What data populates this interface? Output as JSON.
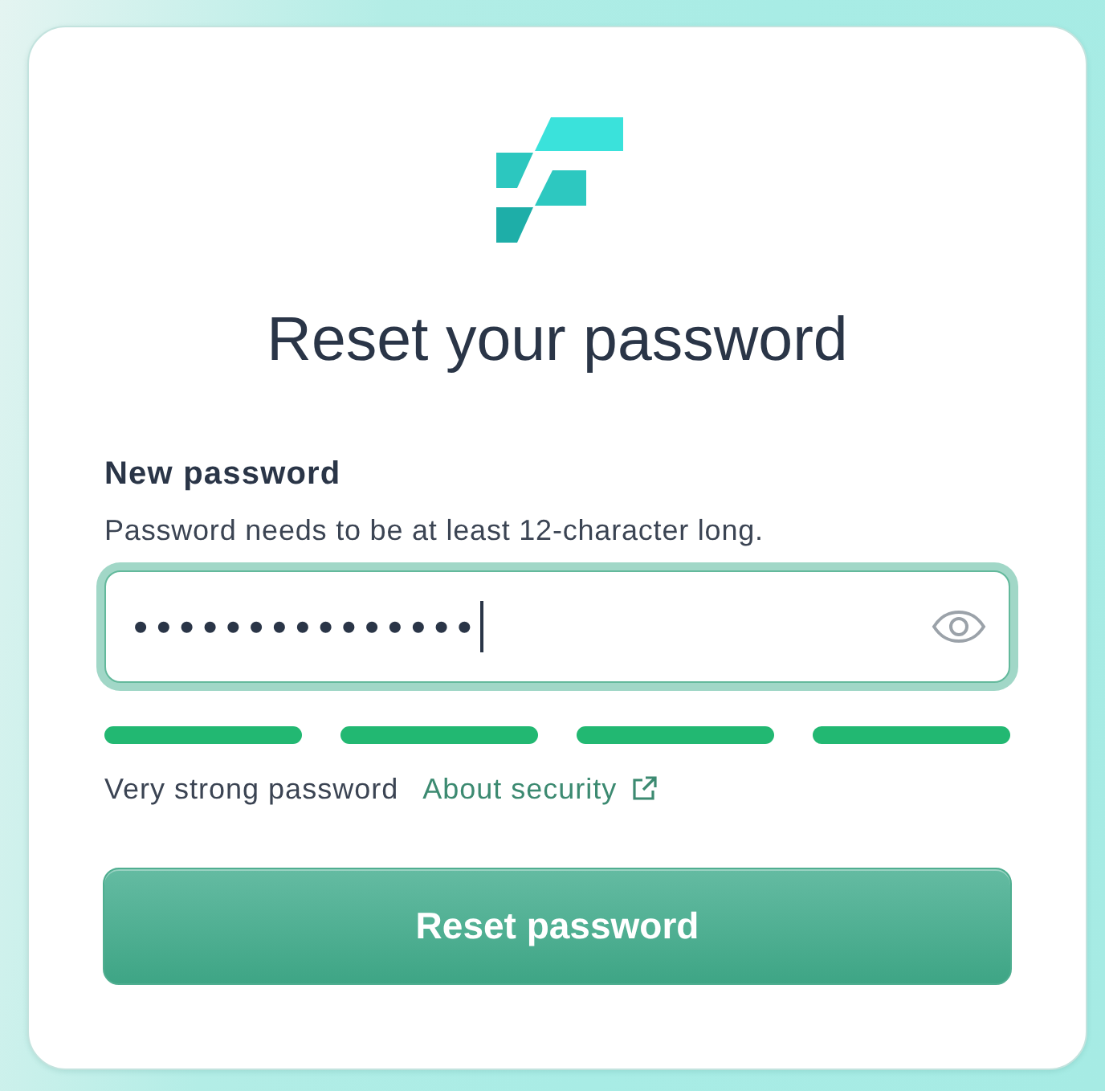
{
  "title": "Reset your password",
  "password_field": {
    "label": "New password",
    "hint": "Password needs to be at least 12-character long.",
    "value": "•••••••••••••••",
    "focused": true
  },
  "strength_meter": {
    "level": 1,
    "label": "Very strong password"
  },
  "security_link": {
    "label": "About security",
    "external": true
  },
  "submit_button": {
    "label": "Reset password"
  }
}
